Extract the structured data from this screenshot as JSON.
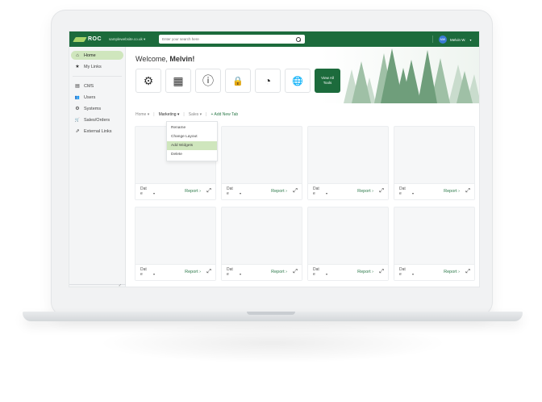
{
  "topbar": {
    "logo": "ROC",
    "site": "samplewebsite.co.uk",
    "search_placeholder": "Enter your search here",
    "user_initials": "MW",
    "user_name": "Melvin W."
  },
  "sidebar": {
    "items": [
      {
        "label": "Home",
        "icon": "home-icon",
        "glyph": "⌂"
      },
      {
        "label": "My Links",
        "icon": "star-icon",
        "glyph": "★"
      },
      {
        "label": "CMS",
        "icon": "document-icon",
        "glyph": "▤"
      },
      {
        "label": "Users",
        "icon": "users-icon",
        "glyph": "👥"
      },
      {
        "label": "Systems",
        "icon": "gear-icon",
        "glyph": "⚙"
      },
      {
        "label": "Sales/Orders",
        "icon": "cart-icon",
        "glyph": "🛒"
      },
      {
        "label": "External Links",
        "icon": "external-link-icon",
        "glyph": "⇗"
      }
    ]
  },
  "hero": {
    "welcome_prefix": "Welcome,",
    "welcome_name": "Melvin!",
    "tools": [
      {
        "name": "settings-tool-icon",
        "glyph": "⚙"
      },
      {
        "name": "calendar-tool-icon",
        "glyph": "▦"
      },
      {
        "name": "info-tool-icon",
        "glyph": "ⓘ"
      },
      {
        "name": "lock-tool-icon",
        "glyph": "🔒"
      },
      {
        "name": "speedometer-tool-icon",
        "glyph": "◔"
      },
      {
        "name": "globe-tool-icon",
        "glyph": "🌐"
      }
    ],
    "view_all_line1": "View All",
    "view_all_line2": "Tools"
  },
  "tabs": {
    "home": "Home ▾",
    "marketing": "Marketing ▾",
    "sales": "Sales ▾",
    "sep": "|",
    "add": "+ Add New Tab"
  },
  "dropdown": {
    "items": [
      "Rename",
      "Change Layout",
      "Add Widgets",
      "Delete"
    ],
    "highlighted_index": 2
  },
  "widgets": {
    "date_top": "Dat",
    "date_bottom": "e",
    "caret": "▾",
    "report": "Report ›",
    "expand": "⤢",
    "count": 8
  },
  "colors": {
    "brand_green": "#1c6b3c",
    "highlight_green": "#cfe6bd",
    "link_green": "#2d7a4a"
  }
}
